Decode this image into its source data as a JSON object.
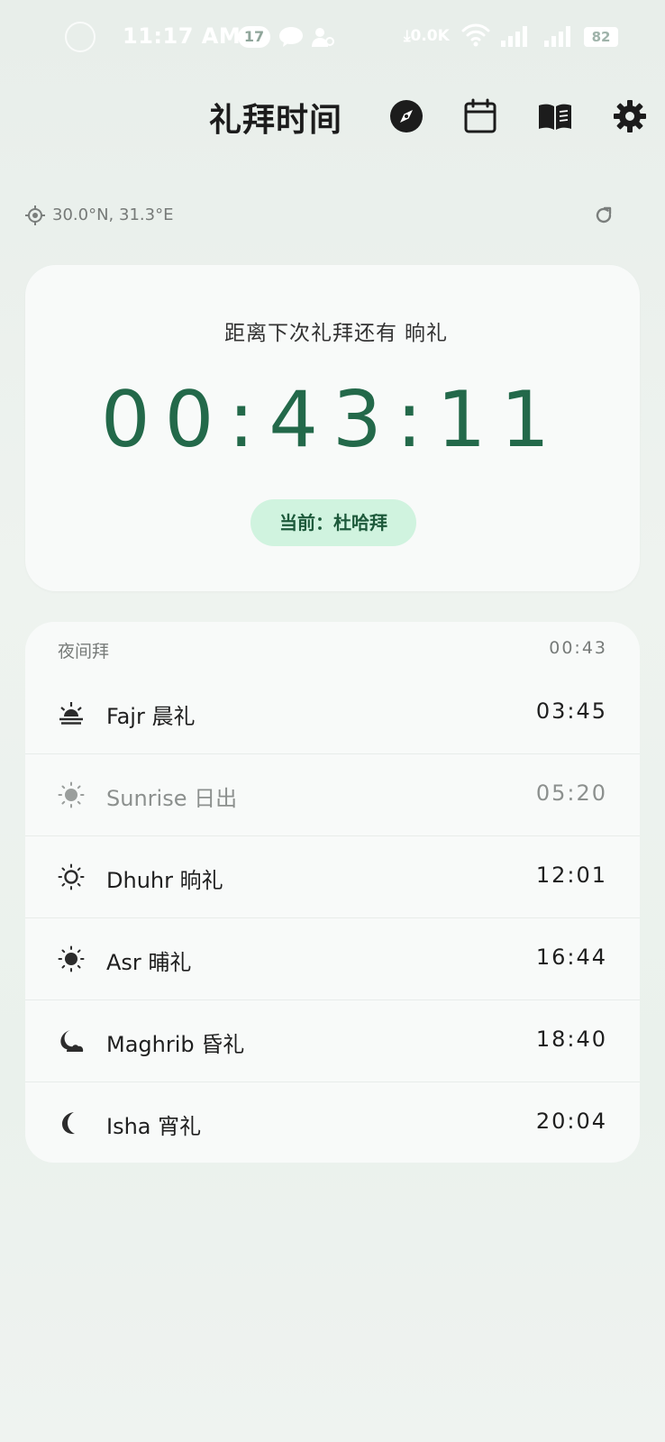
{
  "status_bar": {
    "time": "11:17 AM",
    "notification_count": "17",
    "net_speed": "0.0K",
    "battery": "82"
  },
  "header": {
    "title": "礼拜时间",
    "icons": [
      "compass-icon",
      "calendar-icon",
      "quran-book-icon",
      "gear-icon"
    ]
  },
  "location": {
    "coords": "30.0°N, 31.3°E"
  },
  "countdown": {
    "label": "距离下次礼拜还有",
    "next_prayer": "晌礼",
    "timer": "00:43:11",
    "current_badge": "当前：杜哈拜"
  },
  "night_prayer": {
    "label": "夜间拜",
    "time": "00:43"
  },
  "prayers": [
    {
      "name": "Fajr 晨礼",
      "time": "03:45",
      "icon": "sunrise-horizon-icon"
    },
    {
      "name": "Sunrise 日出",
      "time": "05:20",
      "icon": "sun-dim-icon"
    },
    {
      "name": "Dhuhr 晌礼",
      "time": "12:01",
      "icon": "sun-outline-icon"
    },
    {
      "name": "Asr 晡礼",
      "time": "16:44",
      "icon": "sun-filled-icon"
    },
    {
      "name": "Maghrib 昏礼",
      "time": "18:40",
      "icon": "moon-clouds-icon"
    },
    {
      "name": "Isha 宵礼",
      "time": "20:04",
      "icon": "crescent-moon-icon"
    }
  ],
  "colors": {
    "accent": "#23694a",
    "badge_bg": "#d0f3df",
    "card_bg": "#f8faf9"
  }
}
